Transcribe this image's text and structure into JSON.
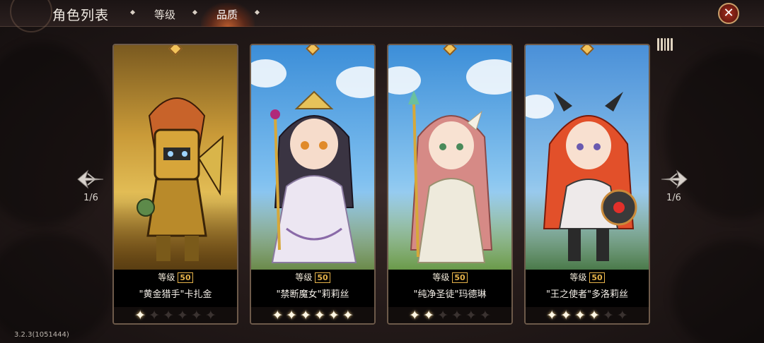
{
  "header": {
    "title": "角色列表",
    "tabs": [
      {
        "label": "等级",
        "active": false
      },
      {
        "label": "品质",
        "active": true
      }
    ],
    "close_icon": "close-icon"
  },
  "pager": {
    "left_indicator": "1/6",
    "right_indicator": "1/6"
  },
  "colors": {
    "accent_orange": "#e66e32",
    "level_gold": "#e6b34a",
    "close_red": "#a62e1e"
  },
  "cards": [
    {
      "level_label": "等级",
      "level_value": "50",
      "name": "\"黄金猎手\"卡扎金",
      "stars_filled": 1,
      "stars_total": 6,
      "theme": "gold-warrior"
    },
    {
      "level_label": "等级",
      "level_value": "50",
      "name": "\"禁断魔女\"莉莉丝",
      "stars_filled": 6,
      "stars_total": 6,
      "theme": "witch-bride"
    },
    {
      "level_label": "等级",
      "level_value": "50",
      "name": "\"纯净圣徒\"玛德琳",
      "stars_filled": 2,
      "stars_total": 6,
      "theme": "holy-priestess"
    },
    {
      "level_label": "等级",
      "level_value": "50",
      "name": "\"王之使者\"多洛莉丝",
      "stars_filled": 4,
      "stars_total": 6,
      "theme": "dragon-girl"
    }
  ],
  "version": "3.2.3(1051444)"
}
